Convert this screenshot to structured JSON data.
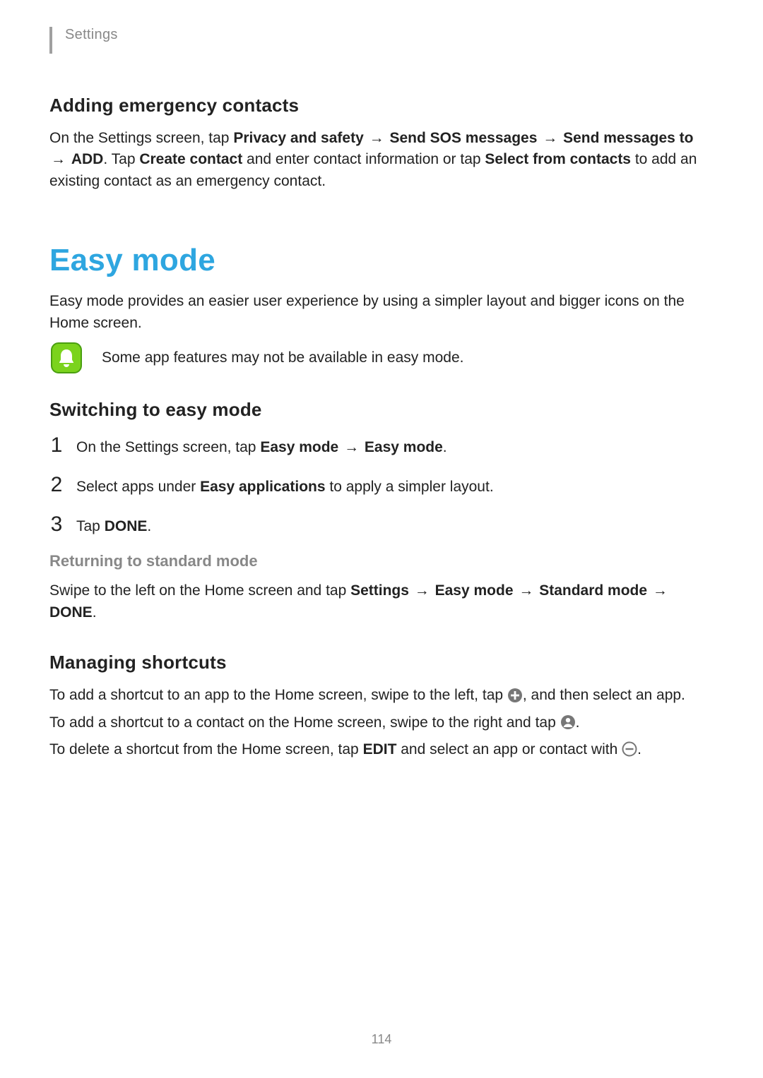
{
  "header": {
    "breadcrumb": "Settings"
  },
  "emergency": {
    "heading": "Adding emergency contacts",
    "p1a": "On the Settings screen, tap ",
    "p1b": "Privacy and safety",
    "p1c": "Send SOS messages",
    "p1d": "Send messages to",
    "p1e": "ADD",
    "p1f": ". Tap ",
    "p1g": "Create contact",
    "p1h": " and enter contact information or tap ",
    "p1i": "Select from contacts",
    "p1j": " to add an existing contact as an emergency contact."
  },
  "arrow": "→",
  "easy": {
    "title": "Easy mode",
    "intro": "Easy mode provides an easier user experience by using a simpler layout and bigger icons on the Home screen.",
    "note": "Some app features may not be available in easy mode."
  },
  "switching": {
    "heading": "Switching to easy mode",
    "steps": {
      "n1": "1",
      "n2": "2",
      "n3": "3",
      "s1a": "On the Settings screen, tap ",
      "s1b": "Easy mode",
      "s1c": "Easy mode",
      "s1d": ".",
      "s2a": "Select apps under ",
      "s2b": "Easy applications",
      "s2c": " to apply a simpler layout.",
      "s3a": "Tap ",
      "s3b": "DONE",
      "s3c": "."
    }
  },
  "returning": {
    "heading": "Returning to standard mode",
    "p1a": "Swipe to the left on the Home screen and tap ",
    "p1b": "Settings",
    "p1c": "Easy mode",
    "p1d": "Standard mode",
    "p1e": "DONE",
    "p1f": "."
  },
  "shortcuts": {
    "heading": "Managing shortcuts",
    "p1a": "To add a shortcut to an app to the Home screen, swipe to the left, tap ",
    "p1b": ", and then select an app.",
    "p2a": "To add a shortcut to a contact on the Home screen, swipe to the right and tap ",
    "p2b": ".",
    "p3a": "To delete a shortcut from the Home screen, tap ",
    "p3b": "EDIT",
    "p3c": " and select an app or contact with ",
    "p3d": "."
  },
  "pageNumber": "114"
}
